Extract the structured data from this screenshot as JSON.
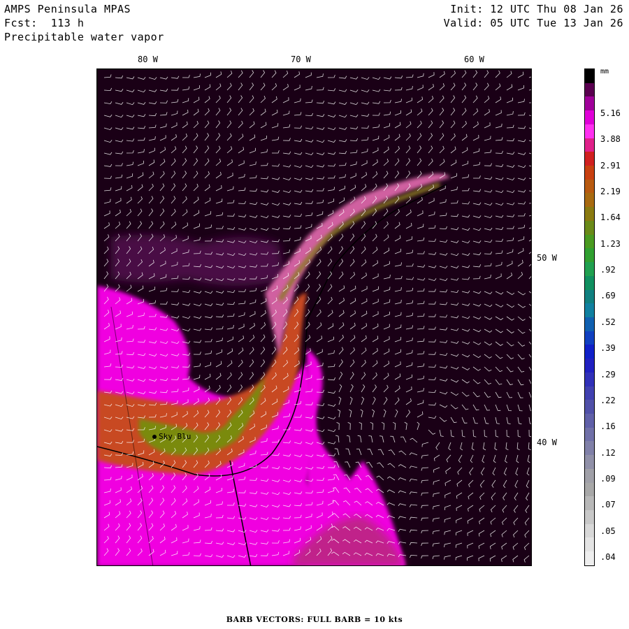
{
  "header": {
    "model": "AMPS Peninsula MPAS",
    "forecast": "Fcst:  113 h",
    "field": "Precipitable water vapor",
    "init": "Init: 12 UTC Thu 08 Jan 26",
    "valid": "Valid: 05 UTC Tue 13 Jan 26"
  },
  "axes": {
    "longitudes": [
      "80 W",
      "70 W",
      "60 W"
    ],
    "latitudes": [
      "50 W",
      "40 W"
    ]
  },
  "station": {
    "name": "Sky Blu"
  },
  "colorbar": {
    "unit": "mm",
    "labels": [
      "5.16",
      "3.88",
      "2.91",
      "2.19",
      "1.64",
      "1.23",
      ".92",
      ".69",
      ".52",
      ".39",
      ".29",
      ".22",
      ".16",
      ".12",
      ".09",
      ".07",
      ".05",
      ".04"
    ],
    "colors": [
      "#000000",
      "#5a0050",
      "#a0009a",
      "#e000d8",
      "#ff30f0",
      "#e0208a",
      "#d02020",
      "#c84010",
      "#b85a10",
      "#a86a10",
      "#8a7a10",
      "#6a8a18",
      "#4a9a20",
      "#30a030",
      "#20a050",
      "#109060",
      "#108080",
      "#1080a0",
      "#1060b0",
      "#1040c0",
      "#1020c8",
      "#2020c0",
      "#3030b8",
      "#4040b0",
      "#5050a8",
      "#6060a8",
      "#7070a8",
      "#8080a8",
      "#9090a8",
      "#a0a0a8",
      "#a8a8a8",
      "#b8b8b8",
      "#c8c8c8",
      "#d8d8d8",
      "#e4e4e4",
      "#eeeeee"
    ]
  },
  "footer": {
    "barb_note": "BARB VECTORS:  FULL BARB = 10 kts"
  }
}
